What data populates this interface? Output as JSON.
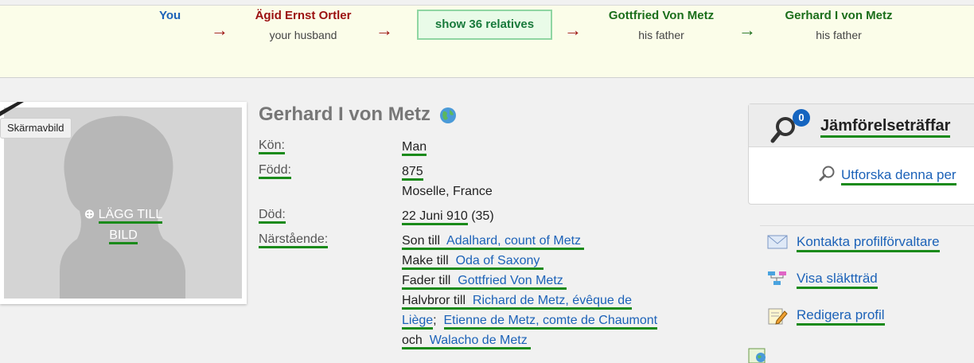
{
  "path": {
    "you": "You",
    "nodes": [
      {
        "name": "Ägid Ernst Ortler",
        "relation": "your husband",
        "color": "#9b1010"
      },
      {
        "name": "Gottfried Von Metz",
        "relation": "his father",
        "color": "#1b6e1b"
      },
      {
        "name": "Gerhard I von Metz",
        "relation": "his father",
        "color": "#1b6e1b"
      }
    ],
    "arrow": "→",
    "relatives_button": "show 36 relatives"
  },
  "photo": {
    "tooltip": "Skärmavbild",
    "add_line1": "LÄGG TILL",
    "add_line2": "BILD"
  },
  "profile": {
    "name": "Gerhard I von Metz",
    "labels": {
      "gender": "Kön:",
      "born": "Född:",
      "died": "Död:",
      "relatives": "Närstående:"
    },
    "gender": "Man",
    "born_year": "875",
    "born_place": "Moselle, France",
    "died_date": "22 Juni 910",
    "died_age": "(35)",
    "relations": {
      "son_of_prefix": "Son till",
      "son_of": "Adalhard, count of Metz",
      "husband_of_prefix": "Make till",
      "husband_of": "Oda of Saxony",
      "father_of_prefix": "Fader till",
      "father_of": "Gottfried Von Metz",
      "half_brother_prefix": "Halvbror till",
      "half_brother_1a": "Richard de Metz, évêque de",
      "half_brother_1b": "Liège",
      "separator": ";",
      "half_brother_2": "Etienne de Metz, comte de Chaumont",
      "and_prefix": "och",
      "half_brother_3": "Walacho de Metz"
    }
  },
  "sidebar": {
    "match_count": "0",
    "match_title": "Jämförelseträffar",
    "explore": "Utforska denna per",
    "contact": "Kontakta profilförvaltare",
    "tree": "Visa släktträd",
    "edit": "Redigera profil"
  }
}
